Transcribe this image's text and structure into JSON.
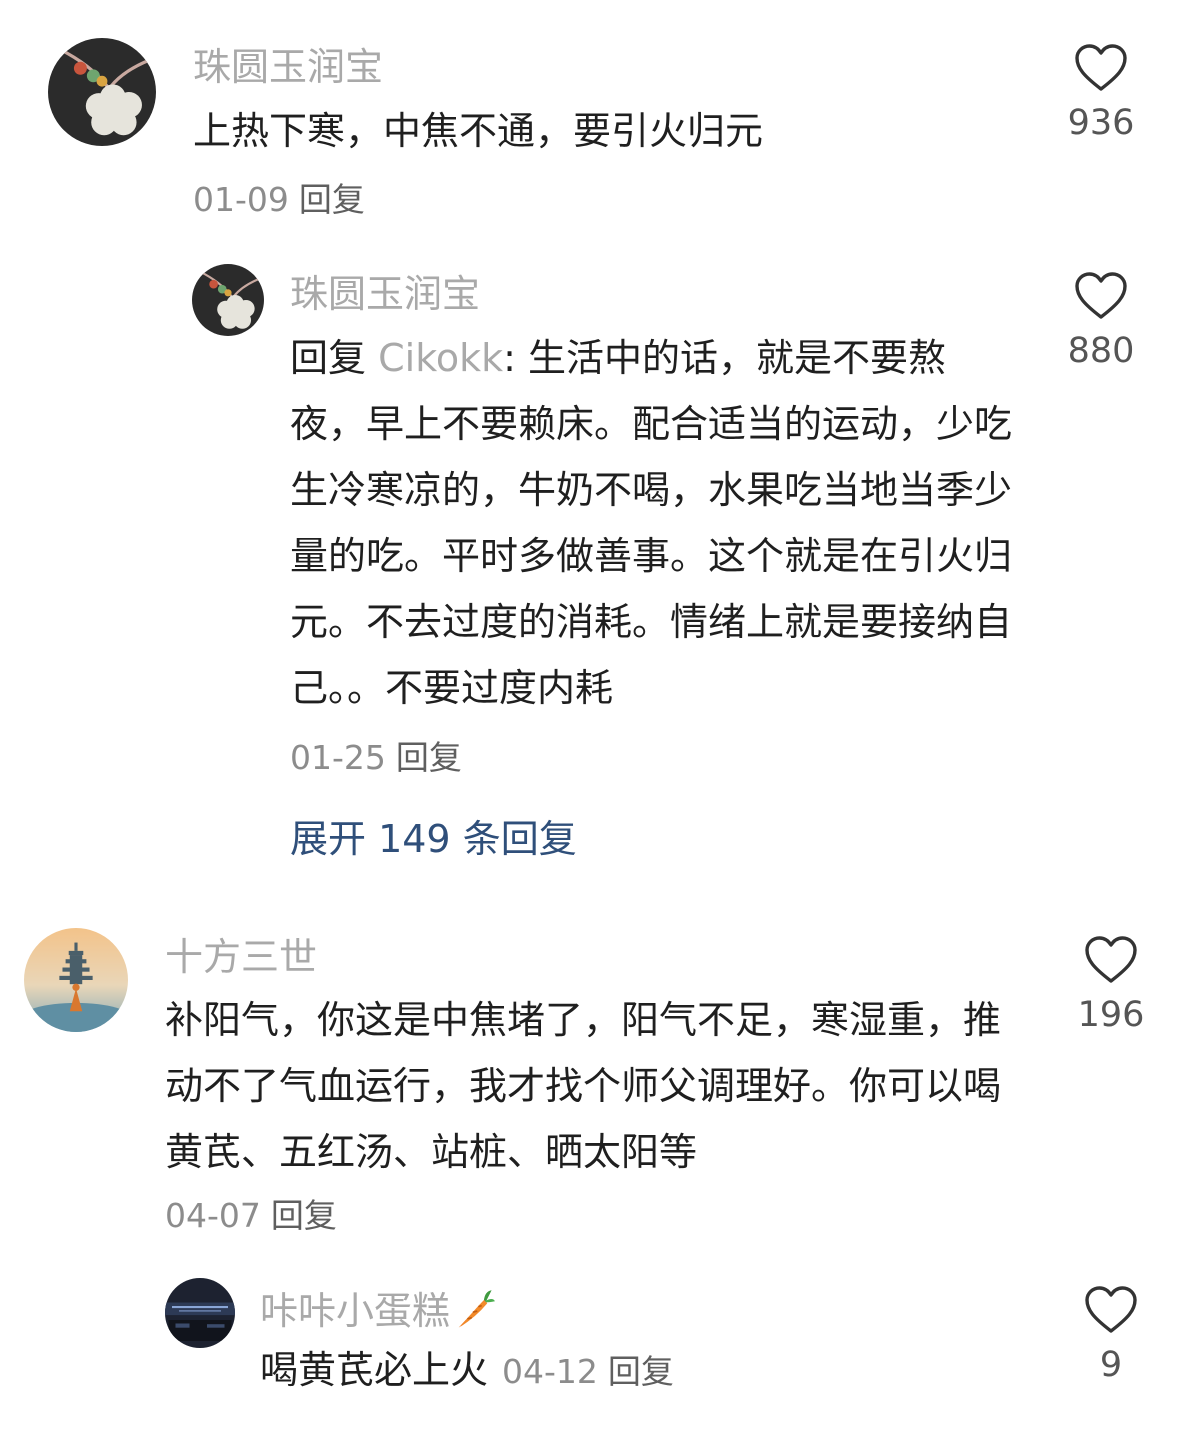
{
  "comments": [
    {
      "username": "珠圆玉润宝",
      "text": "上热下寒，中焦不通，要引火归元",
      "date": "01-09",
      "reply_label": "回复",
      "likes": "936",
      "avatar_icon": "jade-pendant-avatar",
      "replies": [
        {
          "username": "珠圆玉润宝",
          "reply_prefix": "回复",
          "mention": "Cikokk",
          "text": ": 生活中的话，就是不要熬夜，早上不要赖床。配合适当的运动，少吃生冷寒凉的，牛奶不喝，水果吃当地当季少量的吃。平时多做善事。这个就是在引火归元。不去过度的消耗。情绪上就是要接纳自己。。不要过度内耗",
          "date": "01-25",
          "reply_label": "回复",
          "likes": "880",
          "avatar_icon": "jade-pendant-avatar"
        }
      ],
      "expand_label": "展开 149 条回复"
    },
    {
      "username": "十方三世",
      "text": "补阳气，你这是中焦堵了，阳气不足，寒湿重，推动不了气血运行，我才找个师父调理好。你可以喝黄芪、五红汤、站桩、晒太阳等",
      "date": "04-07",
      "reply_label": "回复",
      "likes": "196",
      "avatar_icon": "pagoda-sunset-avatar",
      "replies": [
        {
          "username": "咔咔小蛋糕",
          "username_emoji": "carrot-emoji",
          "text": "喝黄芪必上火",
          "date": "04-12",
          "reply_label": "回复",
          "likes": "9",
          "avatar_icon": "dark-city-avatar"
        }
      ]
    }
  ],
  "colors": {
    "username": "#a9a9a9",
    "text": "#1f1f1f",
    "meta": "#8c8c8c",
    "expand_link": "#2f4f7a",
    "heart_stroke": "#333333"
  }
}
